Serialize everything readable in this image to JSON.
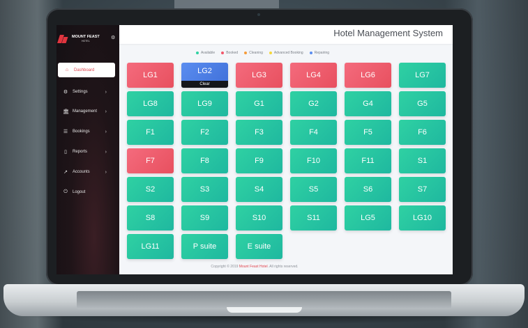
{
  "app": {
    "title": "Hotel Management System",
    "brand_name": "MOUNT FEAST",
    "brand_sub": "HOTEL"
  },
  "sidebar": {
    "items": [
      {
        "label": "Dashboard",
        "icon": "home-icon",
        "glyph": "⌂",
        "active": true,
        "has_submenu": false
      },
      {
        "label": "Settings",
        "icon": "gear-icon",
        "glyph": "⚙",
        "active": false,
        "has_submenu": true
      },
      {
        "label": "Management",
        "icon": "bank-icon",
        "glyph": "🏛",
        "active": false,
        "has_submenu": true
      },
      {
        "label": "Bookings",
        "icon": "list-icon",
        "glyph": "☰",
        "active": false,
        "has_submenu": true
      },
      {
        "label": "Reports",
        "icon": "document-icon",
        "glyph": "▯",
        "active": false,
        "has_submenu": true
      },
      {
        "label": "Accounts",
        "icon": "chart-icon",
        "glyph": "↗",
        "active": false,
        "has_submenu": true
      },
      {
        "label": "Logout",
        "icon": "power-icon",
        "glyph": "⏻",
        "active": false,
        "has_submenu": false
      }
    ]
  },
  "legend": [
    {
      "label": "Available",
      "color": "#2fd1a2"
    },
    {
      "label": "Booked",
      "color": "#f2566a"
    },
    {
      "label": "Cleaning",
      "color": "#f59b3a"
    },
    {
      "label": "Advanced Booking",
      "color": "#f5d73a"
    },
    {
      "label": "Repairing",
      "color": "#5a8df0"
    }
  ],
  "rooms": [
    {
      "name": "LG1",
      "status": "booked"
    },
    {
      "name": "LG2",
      "status": "selected",
      "action": "Clear"
    },
    {
      "name": "LG3",
      "status": "booked"
    },
    {
      "name": "LG4",
      "status": "booked"
    },
    {
      "name": "LG6",
      "status": "booked"
    },
    {
      "name": "LG7",
      "status": "available"
    },
    {
      "name": "LG8",
      "status": "available"
    },
    {
      "name": "LG9",
      "status": "available"
    },
    {
      "name": "G1",
      "status": "available"
    },
    {
      "name": "G2",
      "status": "available"
    },
    {
      "name": "G4",
      "status": "available"
    },
    {
      "name": "G5",
      "status": "available"
    },
    {
      "name": "F1",
      "status": "available"
    },
    {
      "name": "F2",
      "status": "available"
    },
    {
      "name": "F3",
      "status": "available"
    },
    {
      "name": "F4",
      "status": "available"
    },
    {
      "name": "F5",
      "status": "available"
    },
    {
      "name": "F6",
      "status": "available"
    },
    {
      "name": "F7",
      "status": "booked"
    },
    {
      "name": "F8",
      "status": "available"
    },
    {
      "name": "F9",
      "status": "available"
    },
    {
      "name": "F10",
      "status": "available"
    },
    {
      "name": "F11",
      "status": "available"
    },
    {
      "name": "S1",
      "status": "available"
    },
    {
      "name": "S2",
      "status": "available"
    },
    {
      "name": "S3",
      "status": "available"
    },
    {
      "name": "S4",
      "status": "available"
    },
    {
      "name": "S5",
      "status": "available"
    },
    {
      "name": "S6",
      "status": "available"
    },
    {
      "name": "S7",
      "status": "available"
    },
    {
      "name": "S8",
      "status": "available"
    },
    {
      "name": "S9",
      "status": "available"
    },
    {
      "name": "S10",
      "status": "available"
    },
    {
      "name": "S11",
      "status": "available"
    },
    {
      "name": "LG5",
      "status": "available"
    },
    {
      "name": "LG10",
      "status": "available"
    },
    {
      "name": "LG11",
      "status": "available"
    },
    {
      "name": "P suite",
      "status": "available"
    },
    {
      "name": "E suite",
      "status": "available"
    }
  ],
  "footer": {
    "prefix": "Copyright © 2019",
    "brand": "Mount Feast Hotel",
    "suffix": ". All rights reserved."
  }
}
